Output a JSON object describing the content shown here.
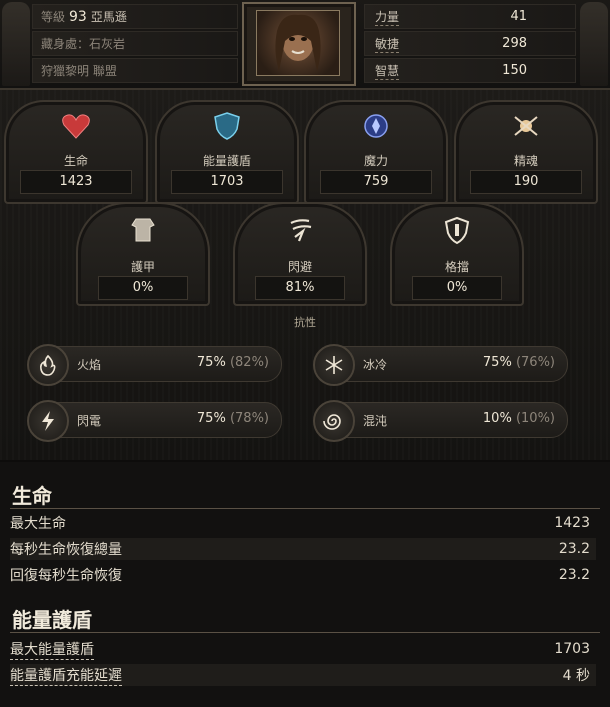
{
  "header": {
    "level_label": "等級",
    "level_value": "93",
    "class_name": "亞馬遜",
    "stash_label": "藏身處：石灰岩",
    "league": "狩獵黎明 聯盟"
  },
  "attributes": [
    {
      "label": "力量",
      "value": "41"
    },
    {
      "label": "敏捷",
      "value": "298"
    },
    {
      "label": "智慧",
      "value": "150"
    }
  ],
  "core_stats": [
    {
      "name": "生命",
      "value": "1423",
      "icon": "heart-icon",
      "color": "#d04040"
    },
    {
      "name": "能量護盾",
      "value": "1703",
      "icon": "shield-icon",
      "color": "#5ab8d8"
    },
    {
      "name": "魔力",
      "value": "759",
      "icon": "mana-icon",
      "color": "#5a7ad8"
    },
    {
      "name": "精魂",
      "value": "190",
      "icon": "spirit-icon",
      "color": "#e0c090"
    }
  ],
  "defense_stats": [
    {
      "name": "護甲",
      "value": "0%",
      "icon": "armour-icon"
    },
    {
      "name": "閃避",
      "value": "81%",
      "icon": "evasion-icon"
    },
    {
      "name": "格擋",
      "value": "0%",
      "icon": "block-icon"
    }
  ],
  "resistances": {
    "title": "抗性",
    "items": [
      {
        "name": "火焰",
        "value": "75%",
        "max": "(82%)",
        "icon": "fire-icon"
      },
      {
        "name": "冰冷",
        "value": "75%",
        "max": "(76%)",
        "icon": "cold-icon"
      },
      {
        "name": "閃電",
        "value": "75%",
        "max": "(78%)",
        "icon": "lightning-icon"
      },
      {
        "name": "混沌",
        "value": "10%",
        "max": "(10%)",
        "icon": "chaos-icon"
      }
    ]
  },
  "life_section": {
    "title": "生命",
    "rows": [
      {
        "label": "最大生命",
        "value": "1423"
      },
      {
        "label": "每秒生命恢復總量",
        "value": "23.2"
      },
      {
        "label": "回復每秒生命恢復",
        "value": "23.2"
      }
    ]
  },
  "es_section": {
    "title": "能量護盾",
    "rows": [
      {
        "label": "最大能量護盾",
        "value": "1703"
      },
      {
        "label": "能量護盾充能延遲",
        "value": "4 秒"
      }
    ]
  }
}
